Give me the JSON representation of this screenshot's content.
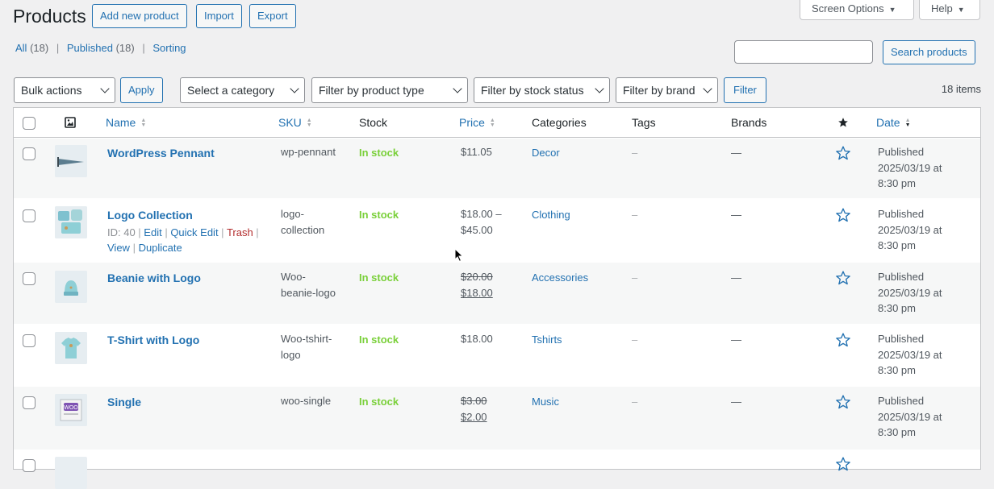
{
  "header": {
    "title": "Products",
    "add_new": "Add new product",
    "import": "Import",
    "export": "Export",
    "screen_options": "Screen Options",
    "help": "Help"
  },
  "views": {
    "all": "All",
    "all_count": "(18)",
    "published": "Published",
    "published_count": "(18)",
    "sorting": "Sorting"
  },
  "search": {
    "button": "Search products",
    "value": ""
  },
  "filters": {
    "bulk_actions": "Bulk actions",
    "apply": "Apply",
    "category": "Select a category",
    "product_type": "Filter by product type",
    "stock_status": "Filter by stock status",
    "brand": "Filter by brand",
    "filter": "Filter",
    "items_count": "18 items"
  },
  "columns": {
    "name": "Name",
    "sku": "SKU",
    "stock": "Stock",
    "price": "Price",
    "categories": "Categories",
    "tags": "Tags",
    "brands": "Brands",
    "date": "Date"
  },
  "rows": [
    {
      "name": "WordPress Pennant",
      "sku": "wp-pennant",
      "stock": "In stock",
      "price": "$11.05",
      "category": "Decor",
      "tags": "–",
      "brands": "—",
      "date_status": "Published",
      "date_value": "2025/03/19 at",
      "date_time": "8:30 pm",
      "thumb": "pennant-image"
    },
    {
      "name": "Logo Collection",
      "sku_1": "logo-",
      "sku_2": "collection",
      "stock": "In stock",
      "price_1": "$18.00 –",
      "price_2": "$45.00",
      "category": "Clothing",
      "tags": "–",
      "brands": "—",
      "date_status": "Published",
      "date_value": "2025/03/19 at",
      "date_time": "8:30 pm",
      "thumb": "logo-collection-image",
      "actions": {
        "id": "ID: 40",
        "edit": "Edit",
        "quick_edit": "Quick Edit",
        "trash": "Trash",
        "view": "View",
        "duplicate": "Duplicate"
      }
    },
    {
      "name": "Beanie with Logo",
      "sku_1": "Woo-",
      "sku_2": "beanie-logo",
      "stock": "In stock",
      "regular_price": "$20.00",
      "sale_price": "$18.00",
      "category": "Accessories",
      "tags": "–",
      "brands": "—",
      "date_status": "Published",
      "date_value": "2025/03/19 at",
      "date_time": "8:30 pm",
      "thumb": "beanie-image"
    },
    {
      "name": "T-Shirt with Logo",
      "sku_1": "Woo-tshirt-",
      "sku_2": "logo",
      "stock": "In stock",
      "price": "$18.00",
      "category": "Tshirts",
      "tags": "–",
      "brands": "—",
      "date_status": "Published",
      "date_value": "2025/03/19 at",
      "date_time": "8:30 pm",
      "thumb": "tshirt-image"
    },
    {
      "name": "Single",
      "sku": "woo-single",
      "stock": "In stock",
      "regular_price": "$3.00",
      "sale_price": "$2.00",
      "category": "Music",
      "tags": "–",
      "brands": "—",
      "date_status": "Published",
      "date_value": "2025/03/19 at",
      "date_time": "8:30 pm",
      "thumb": "single-image"
    }
  ],
  "colors": {
    "link": "#2271b1",
    "in_stock": "#7ad03a",
    "trash": "#b32d2e"
  }
}
